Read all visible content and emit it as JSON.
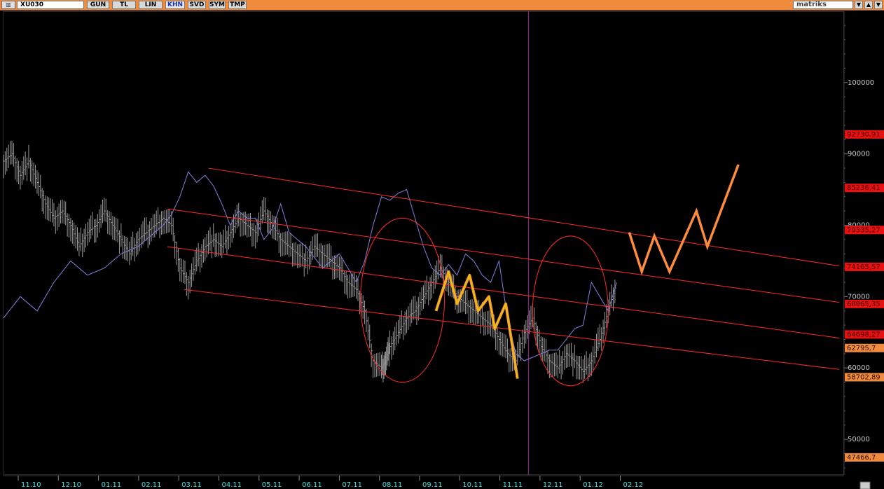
{
  "toolbar": {
    "symbol": "XU030",
    "buttons": [
      "GUN",
      "TL",
      "LIN",
      "KHN",
      "SVD",
      "SYM",
      "TMP"
    ],
    "active_button": "KHN",
    "brand": "matriks"
  },
  "colors": {
    "toolbar_bg": "#f08a3c",
    "channel": "#ff2a2a",
    "price_bars": "#9a9a9a",
    "overlay_line": "#8080e0",
    "projection": "#ff8c3c",
    "swing_highlight": "#d8d000",
    "axis_labels": "#c8c8c8",
    "date_labels": "#40e0e0",
    "vertical_marker": "#a020a0"
  },
  "chart_data": {
    "type": "line",
    "y_axis": {
      "ylim": [
        45000,
        110000
      ],
      "ticks": [
        50000,
        60000,
        70000,
        80000,
        90000,
        100000
      ],
      "tick_labels": [
        "50000",
        "60000",
        "70000",
        "80000",
        "90000",
        "100000"
      ]
    },
    "price_levels": [
      {
        "value": 92730.91,
        "label": "92730,91",
        "style": "red"
      },
      {
        "value": 85236.41,
        "label": "85236,41",
        "style": "red"
      },
      {
        "value": 79335.27,
        "label": "79335,27",
        "style": "red"
      },
      {
        "value": 74165.57,
        "label": "74165,57",
        "style": "red"
      },
      {
        "value": 68965.35,
        "label": "68965,35",
        "style": "red"
      },
      {
        "value": 64698.27,
        "label": "64698,27",
        "style": "red"
      },
      {
        "value": 62795.7,
        "label": "62795,7",
        "style": "orange"
      },
      {
        "value": 58702.89,
        "label": "58702,89",
        "style": "orange"
      },
      {
        "value": 47466.7,
        "label": "47466,7",
        "style": "orange"
      }
    ],
    "x_labels": [
      "11.10",
      "12.10",
      "01.11",
      "02.11",
      "03.11",
      "04.11",
      "05.11",
      "06.11",
      "07.11",
      "08.11",
      "09.11",
      "10.11",
      "11.11",
      "12.11",
      "01.12",
      "02.12"
    ],
    "channels": [
      {
        "x": [
          0.244,
          0.995
        ],
        "y": [
          88000,
          74300
        ]
      },
      {
        "x": [
          0.195,
          0.995
        ],
        "y": [
          82300,
          69200
        ]
      },
      {
        "x": [
          0.195,
          0.995
        ],
        "y": [
          77000,
          64200
        ]
      },
      {
        "x": [
          0.215,
          0.995
        ],
        "y": [
          71000,
          59800
        ]
      }
    ],
    "price_series": {
      "x": [
        0.0,
        0.01,
        0.02,
        0.03,
        0.04,
        0.05,
        0.06,
        0.07,
        0.08,
        0.09,
        0.1,
        0.11,
        0.12,
        0.13,
        0.14,
        0.15,
        0.16,
        0.17,
        0.18,
        0.19,
        0.2,
        0.21,
        0.22,
        0.23,
        0.24,
        0.25,
        0.26,
        0.27,
        0.28,
        0.29,
        0.3,
        0.31,
        0.32,
        0.33,
        0.34,
        0.35,
        0.36,
        0.37,
        0.38,
        0.39,
        0.4,
        0.41,
        0.42,
        0.43,
        0.44,
        0.45,
        0.455,
        0.46,
        0.47,
        0.48,
        0.49,
        0.5,
        0.51,
        0.52,
        0.53,
        0.54,
        0.55,
        0.56,
        0.57,
        0.58,
        0.59,
        0.6,
        0.61,
        0.62,
        0.63,
        0.64,
        0.65,
        0.66,
        0.67,
        0.68,
        0.69,
        0.7,
        0.71,
        0.72,
        0.73
      ],
      "y": [
        89000,
        90000,
        87000,
        89000,
        86000,
        83000,
        81000,
        82000,
        80000,
        77000,
        79000,
        80000,
        82000,
        80000,
        78000,
        76000,
        78000,
        79000,
        80000,
        81000,
        80000,
        74000,
        72000,
        75000,
        77000,
        78000,
        77000,
        79000,
        81000,
        80000,
        79000,
        82000,
        80000,
        78000,
        77000,
        76000,
        75000,
        77000,
        76000,
        75000,
        74000,
        72000,
        71000,
        68000,
        61000,
        60000,
        61000,
        63000,
        65000,
        67000,
        68000,
        70000,
        72000,
        74000,
        72000,
        70000,
        69000,
        68000,
        67000,
        66000,
        64000,
        62000,
        61000,
        65000,
        67000,
        63000,
        61000,
        60000,
        62000,
        61000,
        59500,
        61000,
        64000,
        68000,
        72000
      ]
    },
    "overlay_series": {
      "x": [
        0.0,
        0.02,
        0.04,
        0.06,
        0.08,
        0.1,
        0.12,
        0.14,
        0.16,
        0.18,
        0.19,
        0.2,
        0.21,
        0.22,
        0.23,
        0.24,
        0.25,
        0.26,
        0.27,
        0.28,
        0.29,
        0.3,
        0.31,
        0.32,
        0.33,
        0.34,
        0.36,
        0.38,
        0.4,
        0.42,
        0.43,
        0.44,
        0.45,
        0.46,
        0.47,
        0.48,
        0.49,
        0.5,
        0.51,
        0.52,
        0.53,
        0.54,
        0.55,
        0.56,
        0.57,
        0.58,
        0.59,
        0.6,
        0.61,
        0.62,
        0.63,
        0.64,
        0.65,
        0.66,
        0.67,
        0.68,
        0.69,
        0.7,
        0.71,
        0.72,
        0.73
      ],
      "y": [
        67000,
        70000,
        68000,
        72000,
        75000,
        73000,
        74000,
        76000,
        77000,
        79000,
        80000,
        81500,
        84000,
        87500,
        86000,
        87000,
        85500,
        83000,
        80000,
        82000,
        81000,
        81000,
        78000,
        79500,
        83000,
        79000,
        77000,
        74000,
        76000,
        72000,
        75000,
        80000,
        84000,
        83500,
        84500,
        85000,
        81000,
        77000,
        74000,
        73000,
        74500,
        73000,
        76000,
        75000,
        73000,
        72000,
        75000,
        67000,
        62000,
        61000,
        61500,
        62000,
        62500,
        62500,
        64000,
        65500,
        66000,
        72000,
        70000,
        68000,
        72000
      ]
    },
    "swing_highlight": {
      "x": [
        0.515,
        0.53,
        0.54,
        0.555,
        0.565,
        0.578,
        0.585,
        0.598,
        0.612
      ],
      "y": [
        68000,
        73500,
        69000,
        73000,
        68000,
        70000,
        65500,
        69000,
        58500
      ]
    },
    "projection": {
      "x": [
        0.745,
        0.76,
        0.775,
        0.793,
        0.825,
        0.838,
        0.875
      ],
      "y": [
        79000,
        73500,
        78500,
        73500,
        82000,
        77000,
        88500
      ]
    },
    "ellipses": [
      {
        "cx": 0.475,
        "cy": 69500,
        "rx": 0.05,
        "ry": 11500
      },
      {
        "cx": 0.675,
        "cy": 68000,
        "rx": 0.045,
        "ry": 10500
      }
    ],
    "vertical_marker_x": 0.625
  }
}
